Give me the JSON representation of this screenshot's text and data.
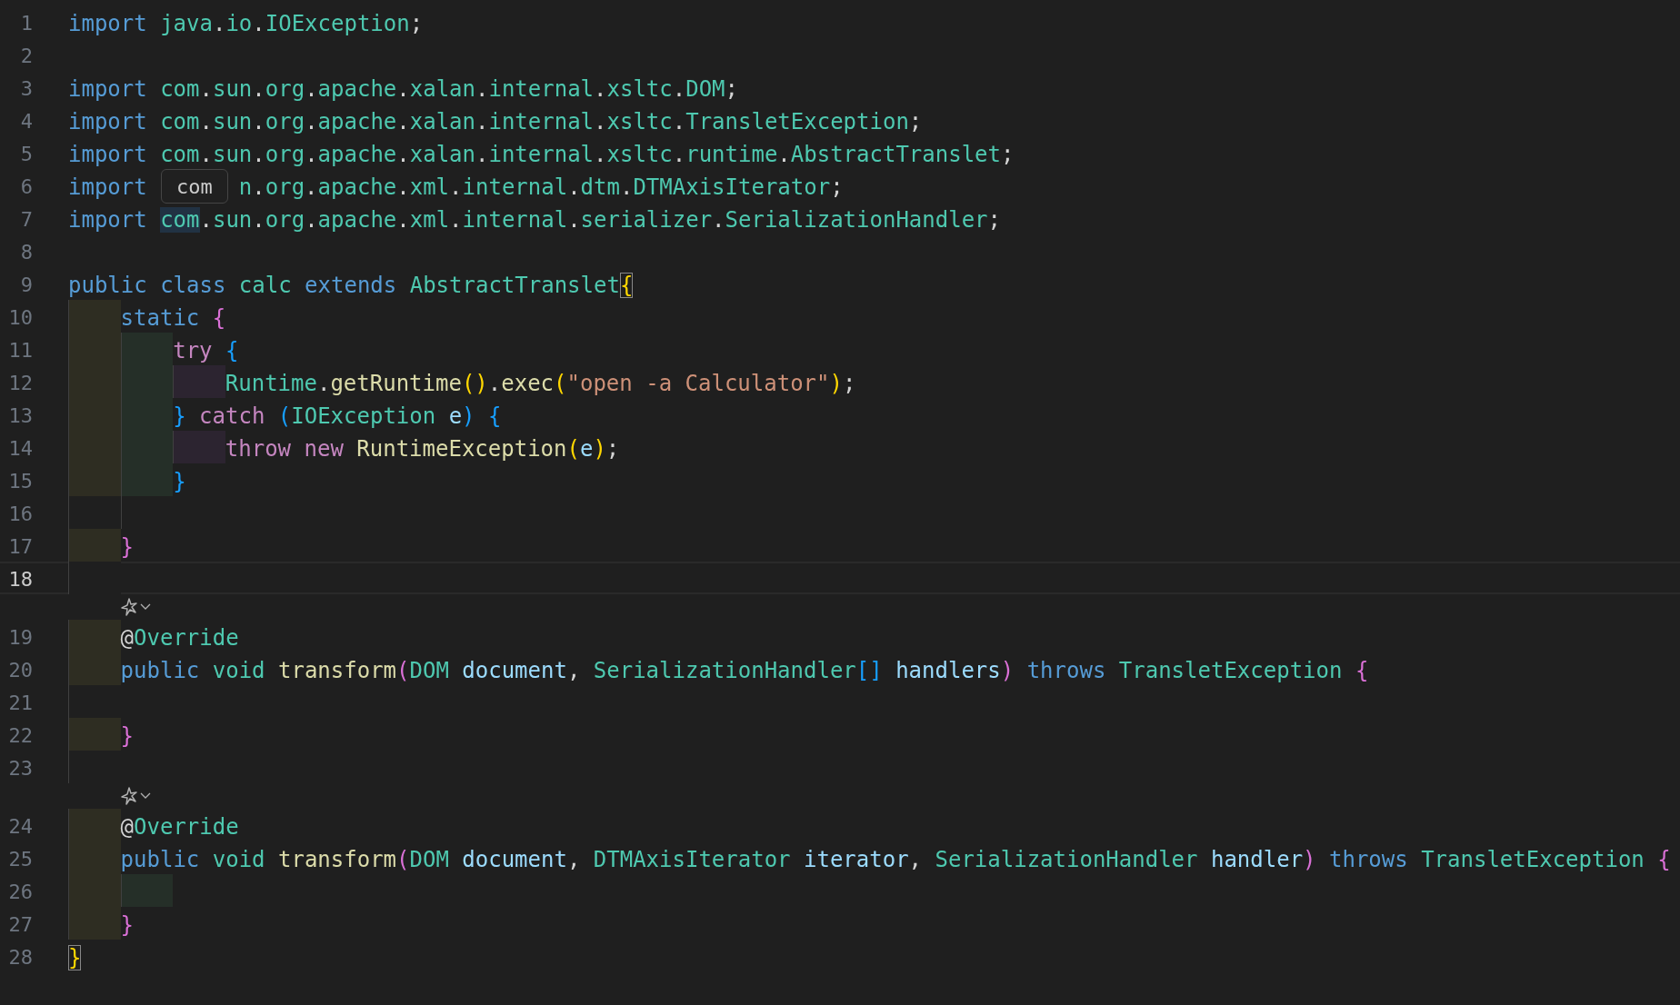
{
  "editor": {
    "lines": [
      {
        "kind": "code",
        "number": "1",
        "tokens": [
          {
            "kind": "keyword",
            "text": "import"
          },
          {
            "kind": "space"
          },
          {
            "kind": "path",
            "text": "java.io.IOException"
          },
          {
            "kind": "plain",
            "text": ";"
          }
        ]
      },
      {
        "kind": "code",
        "number": "2"
      },
      {
        "kind": "code",
        "number": "3",
        "tokens": [
          {
            "kind": "keyword",
            "text": "import"
          },
          {
            "kind": "space"
          },
          {
            "kind": "path",
            "text": "com.sun.org.apache.xalan.internal.xsltc.DOM"
          },
          {
            "kind": "plain",
            "text": ";"
          }
        ]
      },
      {
        "kind": "code",
        "number": "4",
        "tokens": [
          {
            "kind": "keyword",
            "text": "import"
          },
          {
            "kind": "space"
          },
          {
            "kind": "path",
            "text": "com.sun.org.apache.xalan.internal.xsltc.TransletException"
          },
          {
            "kind": "plain",
            "text": ";"
          }
        ]
      },
      {
        "kind": "code",
        "number": "5",
        "tokens": [
          {
            "kind": "keyword",
            "text": "import"
          },
          {
            "kind": "space"
          },
          {
            "kind": "path",
            "text": "com.sun.org.apache.xalan.internal.xsltc.runtime.AbstractTranslet"
          },
          {
            "kind": "plain",
            "text": ";"
          }
        ]
      },
      {
        "kind": "code",
        "number": "6",
        "tokens": [
          {
            "kind": "keyword",
            "text": "import"
          },
          {
            "kind": "covered"
          },
          {
            "kind": "path",
            "text": "n.org.apache.xml.internal.dtm.DTMAxisIterator"
          },
          {
            "kind": "plain",
            "text": ";"
          }
        ]
      },
      {
        "kind": "code",
        "number": "7",
        "tokens": [
          {
            "kind": "keyword",
            "text": "import"
          },
          {
            "kind": "space"
          },
          {
            "kind": "path",
            "text": "com",
            "highlighted": true
          },
          {
            "kind": "path",
            "text": ".sun.org.apache.xml.internal.serializer.SerializationHandler"
          },
          {
            "kind": "plain",
            "text": ";"
          }
        ]
      },
      {
        "kind": "code",
        "number": "8"
      },
      {
        "kind": "code",
        "number": "9",
        "tokens": [
          {
            "kind": "keyword",
            "text": "public"
          },
          {
            "kind": "space"
          },
          {
            "kind": "keyword",
            "text": "class"
          },
          {
            "kind": "space"
          },
          {
            "kind": "type",
            "text": "calc"
          },
          {
            "kind": "space"
          },
          {
            "kind": "keyword",
            "text": "extends"
          },
          {
            "kind": "space"
          },
          {
            "kind": "type",
            "text": "AbstractTranslet"
          },
          {
            "kind": "bracket1",
            "text": "{",
            "matched": true
          }
        ]
      },
      {
        "kind": "code",
        "number": "10",
        "indent": [
          {
            "color": "#2e2d22"
          }
        ],
        "tokens": [
          {
            "kind": "keyword",
            "text": "static"
          },
          {
            "kind": "space"
          },
          {
            "kind": "bracket2",
            "text": "{"
          }
        ]
      },
      {
        "kind": "code",
        "number": "11",
        "indent": [
          {
            "color": "#2e2d22"
          },
          {
            "color": "#252f28"
          }
        ],
        "tokens": [
          {
            "kind": "control",
            "text": "try"
          },
          {
            "kind": "space"
          },
          {
            "kind": "bracket3",
            "text": "{"
          }
        ]
      },
      {
        "kind": "code",
        "number": "12",
        "indent": [
          {
            "color": "#2e2d22"
          },
          {
            "color": "#252f28"
          },
          {
            "color": "#2c2430"
          }
        ],
        "tokens": [
          {
            "kind": "type",
            "text": "Runtime"
          },
          {
            "kind": "plain",
            "text": "."
          },
          {
            "kind": "function",
            "text": "getRuntime"
          },
          {
            "kind": "bracket1",
            "text": "()"
          },
          {
            "kind": "plain",
            "text": "."
          },
          {
            "kind": "function",
            "text": "exec"
          },
          {
            "kind": "bracket1",
            "text": "("
          },
          {
            "kind": "string",
            "text": "\"open -a Calculator\""
          },
          {
            "kind": "bracket1",
            "text": ")"
          },
          {
            "kind": "plain",
            "text": ";"
          }
        ]
      },
      {
        "kind": "code",
        "number": "13",
        "indent": [
          {
            "color": "#2e2d22"
          },
          {
            "color": "#252f28"
          }
        ],
        "tokens": [
          {
            "kind": "bracket3",
            "text": "}"
          },
          {
            "kind": "space"
          },
          {
            "kind": "control",
            "text": "catch"
          },
          {
            "kind": "space"
          },
          {
            "kind": "bracket3",
            "text": "("
          },
          {
            "kind": "type",
            "text": "IOException"
          },
          {
            "kind": "space"
          },
          {
            "kind": "variable",
            "text": "e"
          },
          {
            "kind": "bracket3",
            "text": ")"
          },
          {
            "kind": "space"
          },
          {
            "kind": "bracket3",
            "text": "{"
          }
        ]
      },
      {
        "kind": "code",
        "number": "14",
        "indent": [
          {
            "color": "#2e2d22"
          },
          {
            "color": "#252f28"
          },
          {
            "color": "#2c2430"
          }
        ],
        "tokens": [
          {
            "kind": "control",
            "text": "throw"
          },
          {
            "kind": "space"
          },
          {
            "kind": "control",
            "text": "new"
          },
          {
            "kind": "space"
          },
          {
            "kind": "function",
            "text": "RuntimeException"
          },
          {
            "kind": "bracket1",
            "text": "("
          },
          {
            "kind": "variable",
            "text": "e"
          },
          {
            "kind": "bracket1",
            "text": ")"
          },
          {
            "kind": "plain",
            "text": ";"
          }
        ]
      },
      {
        "kind": "code",
        "number": "15",
        "indent": [
          {
            "color": "#2e2d22"
          },
          {
            "color": "#252f28"
          }
        ],
        "tokens": [
          {
            "kind": "bracket3",
            "text": "}"
          }
        ]
      },
      {
        "kind": "code",
        "number": "16",
        "indent": [
          {
            "color": "#1f1f1f"
          },
          {
            "color": "#1f1f1f"
          }
        ]
      },
      {
        "kind": "code",
        "number": "17",
        "indent": [
          {
            "color": "#2e2d22"
          }
        ],
        "tokens": [
          {
            "kind": "bracket2",
            "text": "}"
          }
        ]
      },
      {
        "kind": "code",
        "number": "18",
        "current": true,
        "indent": [
          {
            "color": "#1f1f1f"
          }
        ]
      },
      {
        "kind": "lens"
      },
      {
        "kind": "code",
        "number": "19",
        "indent": [
          {
            "color": "#2e2d22"
          }
        ],
        "tokens": [
          {
            "kind": "plain",
            "text": "@"
          },
          {
            "kind": "type",
            "text": "Override"
          }
        ]
      },
      {
        "kind": "code",
        "number": "20",
        "indent": [
          {
            "color": "#2e2d22"
          }
        ],
        "tokens": [
          {
            "kind": "keyword",
            "text": "public"
          },
          {
            "kind": "space"
          },
          {
            "kind": "type",
            "text": "void"
          },
          {
            "kind": "space"
          },
          {
            "kind": "function",
            "text": "transform"
          },
          {
            "kind": "bracket2",
            "text": "("
          },
          {
            "kind": "type",
            "text": "DOM"
          },
          {
            "kind": "space"
          },
          {
            "kind": "variable",
            "text": "document"
          },
          {
            "kind": "plain",
            "text": ","
          },
          {
            "kind": "space"
          },
          {
            "kind": "type",
            "text": "SerializationHandler"
          },
          {
            "kind": "bracket3",
            "text": "[]"
          },
          {
            "kind": "space"
          },
          {
            "kind": "variable",
            "text": "handlers"
          },
          {
            "kind": "bracket2",
            "text": ")"
          },
          {
            "kind": "space"
          },
          {
            "kind": "keyword",
            "text": "throws"
          },
          {
            "kind": "space"
          },
          {
            "kind": "type",
            "text": "TransletException"
          },
          {
            "kind": "space"
          },
          {
            "kind": "bracket2",
            "text": "{"
          }
        ]
      },
      {
        "kind": "code",
        "number": "21",
        "indent": [
          {
            "color": "#1f1f1f"
          }
        ]
      },
      {
        "kind": "code",
        "number": "22",
        "indent": [
          {
            "color": "#2e2d22"
          }
        ],
        "tokens": [
          {
            "kind": "bracket2",
            "text": "}"
          }
        ]
      },
      {
        "kind": "code",
        "number": "23",
        "indent": [
          {
            "color": "#1f1f1f"
          }
        ]
      },
      {
        "kind": "lens"
      },
      {
        "kind": "code",
        "number": "24",
        "indent": [
          {
            "color": "#2e2d22"
          }
        ],
        "tokens": [
          {
            "kind": "plain",
            "text": "@"
          },
          {
            "kind": "type",
            "text": "Override"
          }
        ]
      },
      {
        "kind": "code",
        "number": "25",
        "indent": [
          {
            "color": "#2e2d22"
          }
        ],
        "tokens": [
          {
            "kind": "keyword",
            "text": "public"
          },
          {
            "kind": "space"
          },
          {
            "kind": "type",
            "text": "void"
          },
          {
            "kind": "space"
          },
          {
            "kind": "function",
            "text": "transform"
          },
          {
            "kind": "bracket2",
            "text": "("
          },
          {
            "kind": "type",
            "text": "DOM"
          },
          {
            "kind": "space"
          },
          {
            "kind": "variable",
            "text": "document"
          },
          {
            "kind": "plain",
            "text": ","
          },
          {
            "kind": "space"
          },
          {
            "kind": "type",
            "text": "DTMAxisIterator"
          },
          {
            "kind": "space"
          },
          {
            "kind": "variable",
            "text": "iterator"
          },
          {
            "kind": "plain",
            "text": ","
          },
          {
            "kind": "space"
          },
          {
            "kind": "type",
            "text": "SerializationHandler"
          },
          {
            "kind": "space"
          },
          {
            "kind": "variable",
            "text": "handler"
          },
          {
            "kind": "bracket2",
            "text": ")"
          },
          {
            "kind": "space"
          },
          {
            "kind": "keyword",
            "text": "throws"
          },
          {
            "kind": "space"
          },
          {
            "kind": "type",
            "text": "TransletException"
          },
          {
            "kind": "space"
          },
          {
            "kind": "bracket2",
            "text": "{"
          }
        ]
      },
      {
        "kind": "code",
        "number": "26",
        "indent": [
          {
            "color": "#2e2d22"
          },
          {
            "color": "#252f28"
          }
        ]
      },
      {
        "kind": "code",
        "number": "27",
        "indent": [
          {
            "color": "#2e2d22"
          }
        ],
        "tokens": [
          {
            "kind": "bracket2",
            "text": "}"
          }
        ]
      },
      {
        "kind": "code",
        "number": "28",
        "tokens": [
          {
            "kind": "bracket1",
            "text": "}",
            "matched": true
          }
        ]
      }
    ]
  },
  "hover_tooltip": {
    "text": "com"
  }
}
